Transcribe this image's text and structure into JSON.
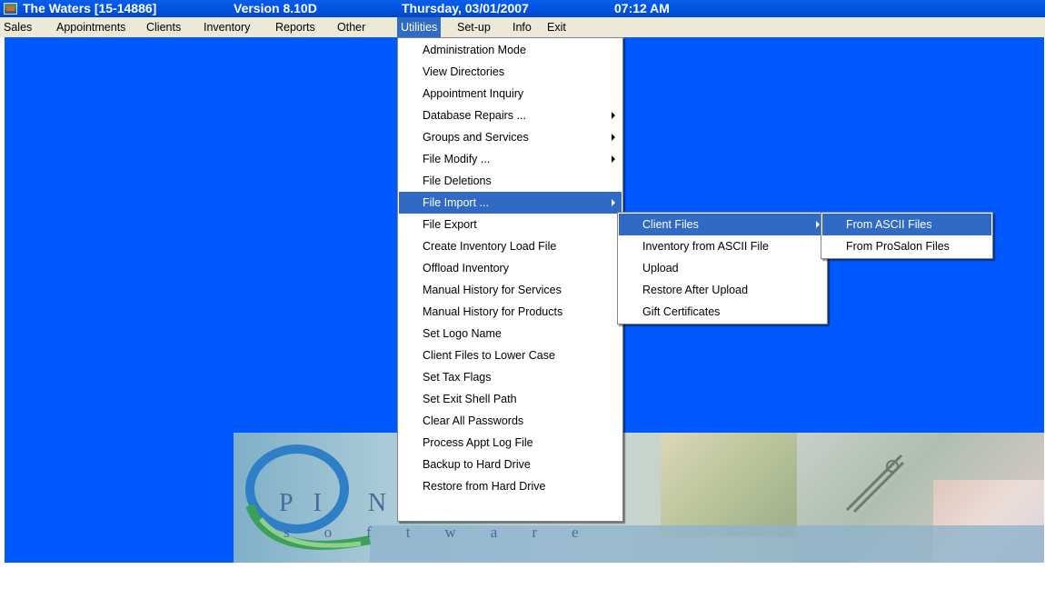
{
  "window": {
    "app_title": "The Waters [15-14886]",
    "version": "Version 8.10D",
    "date": "Thursday, 03/01/2007",
    "time": "07:12 AM"
  },
  "menubar": [
    {
      "label": "Sales",
      "active": false
    },
    {
      "label": "Appointments",
      "active": false
    },
    {
      "label": "Clients",
      "active": false
    },
    {
      "label": "Inventory",
      "active": false
    },
    {
      "label": "Reports",
      "active": false
    },
    {
      "label": "Other",
      "active": false
    },
    {
      "label": "Utilities",
      "active": true
    },
    {
      "label": "Set-up",
      "active": false
    },
    {
      "label": "Info",
      "active": false
    },
    {
      "label": "Exit",
      "active": false
    }
  ],
  "utilities_menu": [
    {
      "label": "Administration Mode",
      "submenu": false
    },
    {
      "label": "View Directories",
      "submenu": false
    },
    {
      "label": "Appointment Inquiry",
      "submenu": false
    },
    {
      "label": "Database Repairs ...",
      "submenu": true
    },
    {
      "label": "Groups and Services",
      "submenu": true
    },
    {
      "label": "File Modify ...",
      "submenu": true
    },
    {
      "label": "File Deletions",
      "submenu": false
    },
    {
      "label": "File Import ...",
      "submenu": true,
      "highlighted": true
    },
    {
      "label": "File Export",
      "submenu": false
    },
    {
      "label": "Create Inventory Load File",
      "submenu": false
    },
    {
      "label": "Offload Inventory",
      "submenu": false
    },
    {
      "label": "Manual History for Services",
      "submenu": false
    },
    {
      "label": "Manual History for Products",
      "submenu": false
    },
    {
      "label": "Set Logo Name",
      "submenu": false
    },
    {
      "label": "Client Files to Lower Case",
      "submenu": false
    },
    {
      "label": "Set Tax Flags",
      "submenu": false
    },
    {
      "label": "Set Exit Shell Path",
      "submenu": false
    },
    {
      "label": "Clear All Passwords",
      "submenu": false
    },
    {
      "label": "Process Appt Log File",
      "submenu": false
    },
    {
      "label": "Backup to Hard Drive",
      "submenu": false
    },
    {
      "label": "Restore from Hard Drive",
      "submenu": false
    }
  ],
  "file_import_menu": [
    {
      "label": "Client Files",
      "submenu": true,
      "highlighted": true
    },
    {
      "label": "Inventory from ASCII File",
      "submenu": false
    },
    {
      "label": "Upload",
      "submenu": false
    },
    {
      "label": "Restore After Upload",
      "submenu": false
    },
    {
      "label": "Gift Certificates",
      "submenu": false
    }
  ],
  "client_files_menu": [
    {
      "label": "From ASCII Files",
      "submenu": false,
      "highlighted": true
    },
    {
      "label": "From ProSalon Files",
      "submenu": false
    }
  ],
  "banner": {
    "logo_word": "PI       NS",
    "logo_sub": "software"
  },
  "icons": {
    "app": "app-icon",
    "submenu": "arrow-right-icon"
  },
  "colors": {
    "desktop": "#0059ff",
    "titlebar": "#0053e0",
    "menubar": "#ece9d8",
    "highlight": "#316ac5"
  }
}
